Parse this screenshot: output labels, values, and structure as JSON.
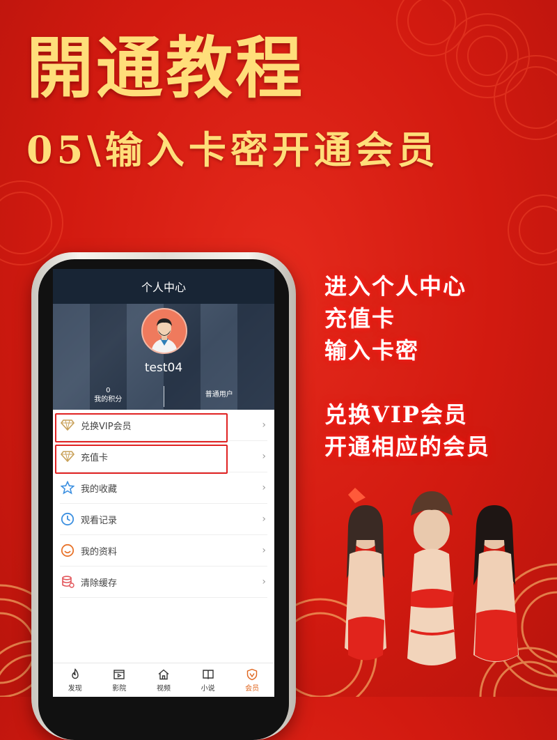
{
  "banner": {
    "title": "開通教程",
    "subtitle": "05\\输入卡密开通会员"
  },
  "instructions": {
    "line1": "进入个人中心",
    "line2": "充值卡",
    "line3": "输入卡密",
    "line4": "兑换VIP会员",
    "line5": "开通相应的会员"
  },
  "app": {
    "header_title": "个人中心",
    "username": "test04",
    "points_value": "0",
    "points_label": "我的积分",
    "user_level": "普通用户",
    "menu": [
      {
        "label": "兑换VIP会员",
        "icon": "diamond-icon"
      },
      {
        "label": "充值卡",
        "icon": "diamond-icon"
      },
      {
        "label": "我的收藏",
        "icon": "star-icon"
      },
      {
        "label": "观看记录",
        "icon": "clock-icon"
      },
      {
        "label": "我的资料",
        "icon": "smile-icon"
      },
      {
        "label": "清除缓存",
        "icon": "database-icon"
      }
    ],
    "tabs": [
      {
        "label": "发现",
        "icon": "fire-icon"
      },
      {
        "label": "影院",
        "icon": "film-icon"
      },
      {
        "label": "视频",
        "icon": "home-icon"
      },
      {
        "label": "小说",
        "icon": "book-icon"
      },
      {
        "label": "会员",
        "icon": "vip-icon"
      }
    ],
    "active_tab": "会员"
  },
  "colors": {
    "background": "#d21a10",
    "title": "#ffde7a",
    "app_header": "#182535",
    "highlight_border": "#e02222",
    "active_tab": "#e0651d"
  }
}
